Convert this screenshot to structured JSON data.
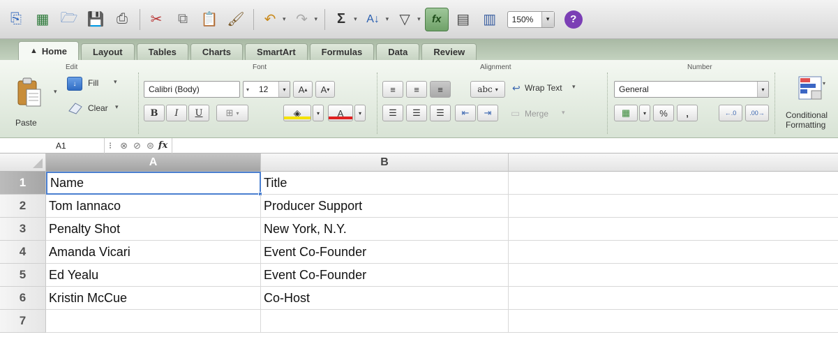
{
  "toolbar": {
    "zoom_value": "150%"
  },
  "tabs": [
    {
      "label": "Home"
    },
    {
      "label": "Layout"
    },
    {
      "label": "Tables"
    },
    {
      "label": "Charts"
    },
    {
      "label": "SmartArt"
    },
    {
      "label": "Formulas"
    },
    {
      "label": "Data"
    },
    {
      "label": "Review"
    }
  ],
  "ribbon": {
    "groups": {
      "edit": "Edit",
      "font": "Font",
      "alignment": "Alignment",
      "number": "Number"
    },
    "paste_label": "Paste",
    "fill_label": "Fill",
    "clear_label": "Clear",
    "font_name": "Calibri (Body)",
    "font_size": "12",
    "bold": "B",
    "italic": "I",
    "underline": "U",
    "wrap_text_label": "Wrap Text",
    "abc_label": "abc",
    "merge_label": "Merge",
    "number_format": "General",
    "percent": "%",
    "comma": ",",
    "conditional_label_1": "Conditional",
    "conditional_label_2": "Formatting",
    "font_color": "#e02020",
    "fill_color": "#f5e200"
  },
  "formula_bar": {
    "name_box": "A1",
    "fx": "fx",
    "value": ""
  },
  "sheet": {
    "columns": [
      "A",
      "B"
    ],
    "rows": [
      {
        "num": "1",
        "a": "Name",
        "b": "Title"
      },
      {
        "num": "2",
        "a": "Tom Iannaco",
        "b": "Producer Support"
      },
      {
        "num": "3",
        "a": "Penalty Shot",
        "b": "New York, N.Y."
      },
      {
        "num": "4",
        "a": "Amanda Vicari",
        "b": "Event Co-Founder"
      },
      {
        "num": "5",
        "a": "Ed Yealu",
        "b": "Event Co-Founder"
      },
      {
        "num": "6",
        "a": "Kristin McCue",
        "b": "Co-Host"
      },
      {
        "num": "7",
        "a": "",
        "b": ""
      }
    ],
    "selected_cell": "A1"
  }
}
